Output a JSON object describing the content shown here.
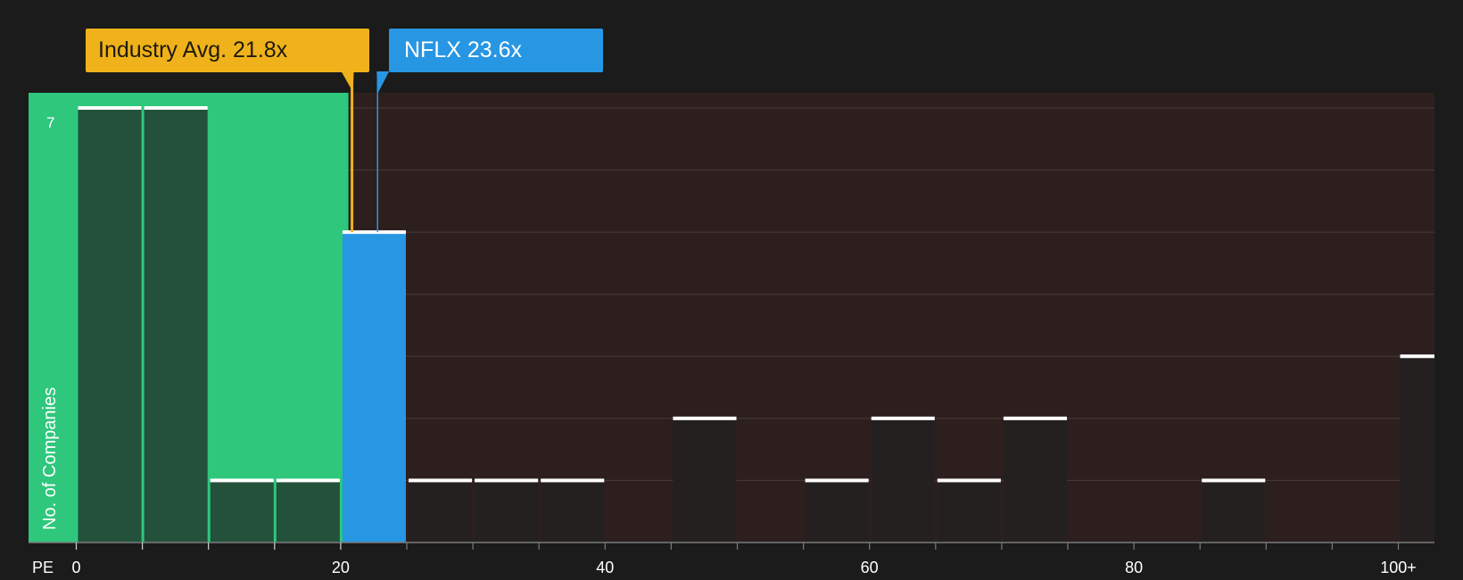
{
  "chart_data": {
    "type": "bar",
    "xlabel": "PE",
    "ylabel": "No. of Companies",
    "xlim": [
      0,
      102.5
    ],
    "ylim": [
      0,
      7
    ],
    "y_tick_labels": [
      {
        "value": 7,
        "label": "7"
      }
    ],
    "x_tick_labels": [
      {
        "value": 0,
        "label": "0"
      },
      {
        "value": 20,
        "label": "20"
      },
      {
        "value": 40,
        "label": "40"
      },
      {
        "value": 60,
        "label": "60"
      },
      {
        "value": 80,
        "label": "80"
      },
      {
        "value": 100,
        "label": "100+"
      }
    ],
    "bins": [
      {
        "start": 0,
        "end": 5,
        "value": 7
      },
      {
        "start": 5,
        "end": 10,
        "value": 7
      },
      {
        "start": 10,
        "end": 15,
        "value": 1
      },
      {
        "start": 15,
        "end": 20,
        "value": 1
      },
      {
        "start": 20,
        "end": 25,
        "value": 5,
        "highlight": true
      },
      {
        "start": 25,
        "end": 30,
        "value": 1
      },
      {
        "start": 30,
        "end": 35,
        "value": 1
      },
      {
        "start": 35,
        "end": 40,
        "value": 1
      },
      {
        "start": 40,
        "end": 45,
        "value": 0
      },
      {
        "start": 45,
        "end": 50,
        "value": 2
      },
      {
        "start": 50,
        "end": 55,
        "value": 0
      },
      {
        "start": 55,
        "end": 60,
        "value": 1
      },
      {
        "start": 60,
        "end": 65,
        "value": 2
      },
      {
        "start": 65,
        "end": 70,
        "value": 1
      },
      {
        "start": 70,
        "end": 75,
        "value": 2
      },
      {
        "start": 75,
        "end": 80,
        "value": 0
      },
      {
        "start": 80,
        "end": 85,
        "value": 0
      },
      {
        "start": 85,
        "end": 90,
        "value": 1
      },
      {
        "start": 90,
        "end": 95,
        "value": 0
      },
      {
        "start": 95,
        "end": 100,
        "value": 0
      },
      {
        "start": 100,
        "end": 105,
        "value": 3
      }
    ],
    "undervalued_threshold": 21.8,
    "industry_avg": {
      "label": "Industry Avg. 21.8x",
      "value": 21.8
    },
    "company": {
      "label": "NFLX 23.6x",
      "value": 23.6
    },
    "gridlines_y": [
      1,
      2,
      3,
      4,
      5,
      6,
      7
    ],
    "colors": {
      "background": "#1b1b1b",
      "undervalued_zone": "#2ec77c",
      "overvalued_zone": "#2e1f1f",
      "bar_green_zone": "#24513b",
      "bar_red_zone": "#252020",
      "highlight_bar": "#2796e3",
      "industry": "#efb21a",
      "company": "#2796e3",
      "gridline": "#4a3a3a",
      "text": "#ffffff"
    }
  }
}
